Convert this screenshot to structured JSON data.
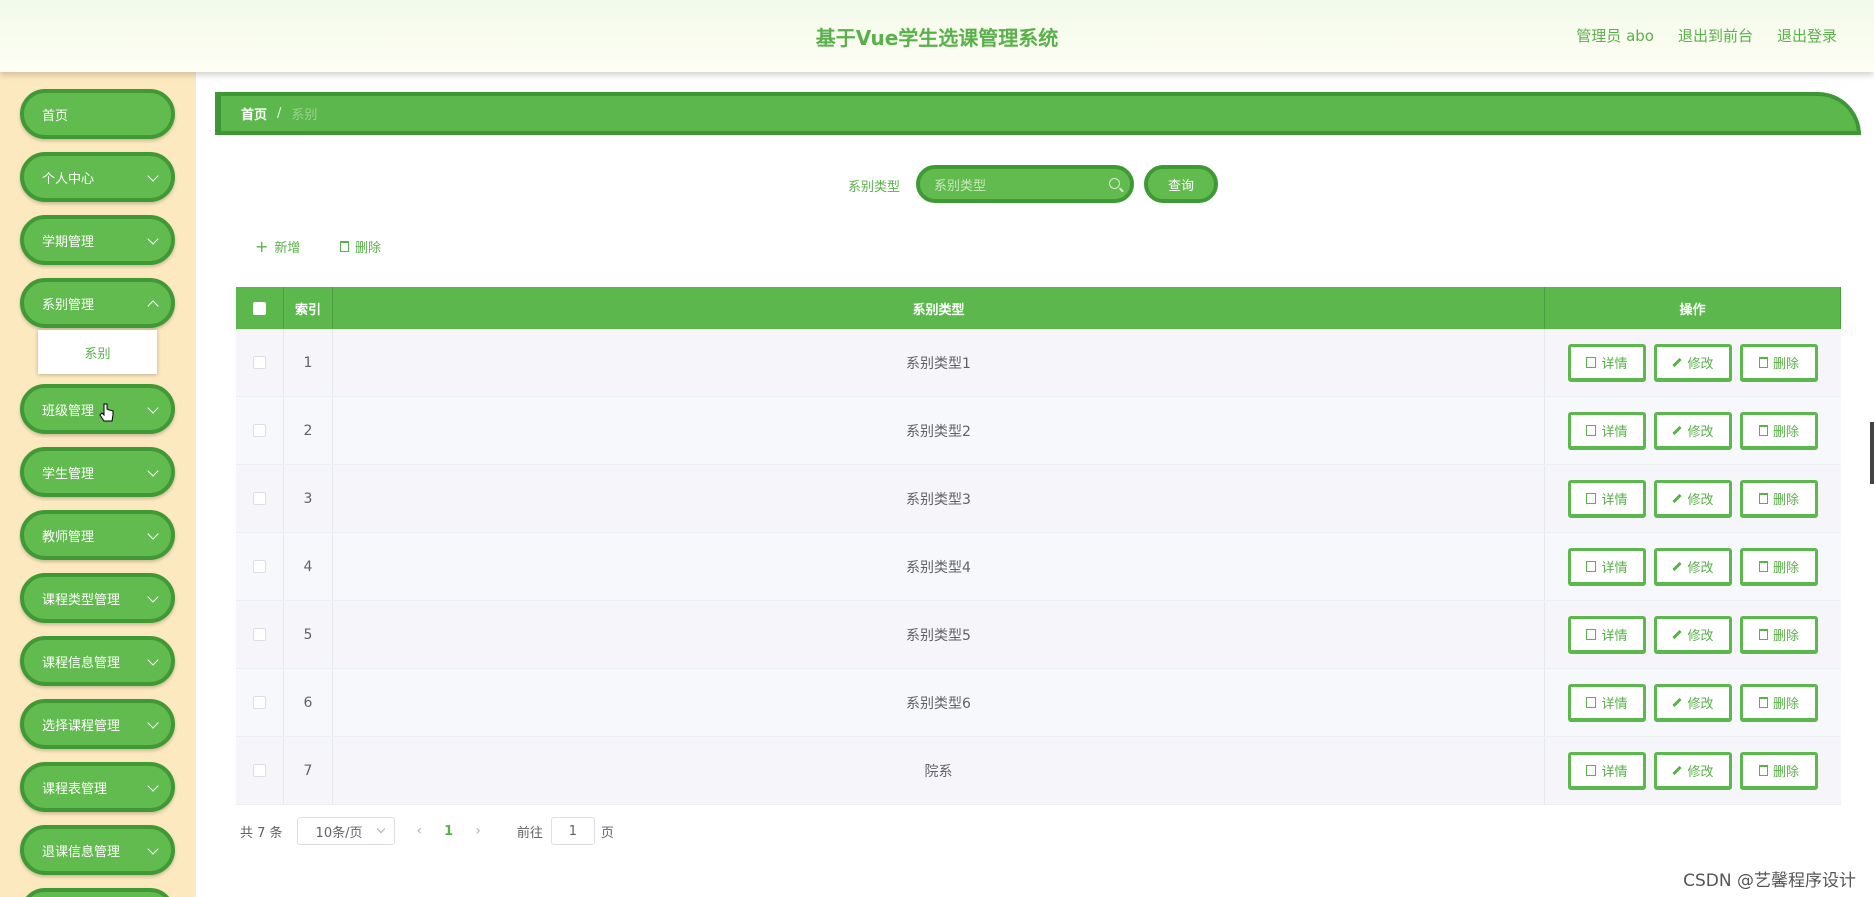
{
  "header": {
    "title": "基于Vue学生选课管理系统",
    "admin": "管理员 abo",
    "to_front": "退出到前台",
    "logout": "退出登录"
  },
  "sidebar": {
    "items": [
      {
        "label": "首页"
      },
      {
        "label": "个人中心"
      },
      {
        "label": "学期管理"
      },
      {
        "label": "系别管理"
      },
      {
        "label": "班级管理"
      },
      {
        "label": "学生管理"
      },
      {
        "label": "教师管理"
      },
      {
        "label": "课程类型管理"
      },
      {
        "label": "课程信息管理"
      },
      {
        "label": "选择课程管理"
      },
      {
        "label": "课程表管理"
      },
      {
        "label": "退课信息管理"
      }
    ],
    "submenu_label": "系别"
  },
  "breadcrumb": {
    "home": "首页",
    "separator": "/",
    "current": "系别"
  },
  "search": {
    "label": "系别类型",
    "placeholder": "系别类型",
    "button": "查询"
  },
  "actions": {
    "add": "新增",
    "delete": "删除"
  },
  "table": {
    "headers": {
      "index": "索引",
      "type": "系别类型",
      "ops": "操作"
    },
    "rows": [
      {
        "index": "1",
        "type": "系别类型1"
      },
      {
        "index": "2",
        "type": "系别类型2"
      },
      {
        "index": "3",
        "type": "系别类型3"
      },
      {
        "index": "4",
        "type": "系别类型4"
      },
      {
        "index": "5",
        "type": "系别类型5"
      },
      {
        "index": "6",
        "type": "系别类型6"
      },
      {
        "index": "7",
        "type": "院系"
      }
    ],
    "row_buttons": {
      "detail": "详情",
      "edit": "修改",
      "delete": "删除"
    }
  },
  "pagination": {
    "total": "共 7 条",
    "page_size": "10条/页",
    "prev": "‹",
    "current_page": "1",
    "next": "›",
    "goto_label": "前往",
    "goto_value": "1",
    "page_word": "页"
  },
  "watermark": "CSDN @艺馨程序设计",
  "colors": {
    "primary": "#5cb84d",
    "primary_dark": "#3f9a35",
    "sidebar_bg": "#fde9bf"
  }
}
